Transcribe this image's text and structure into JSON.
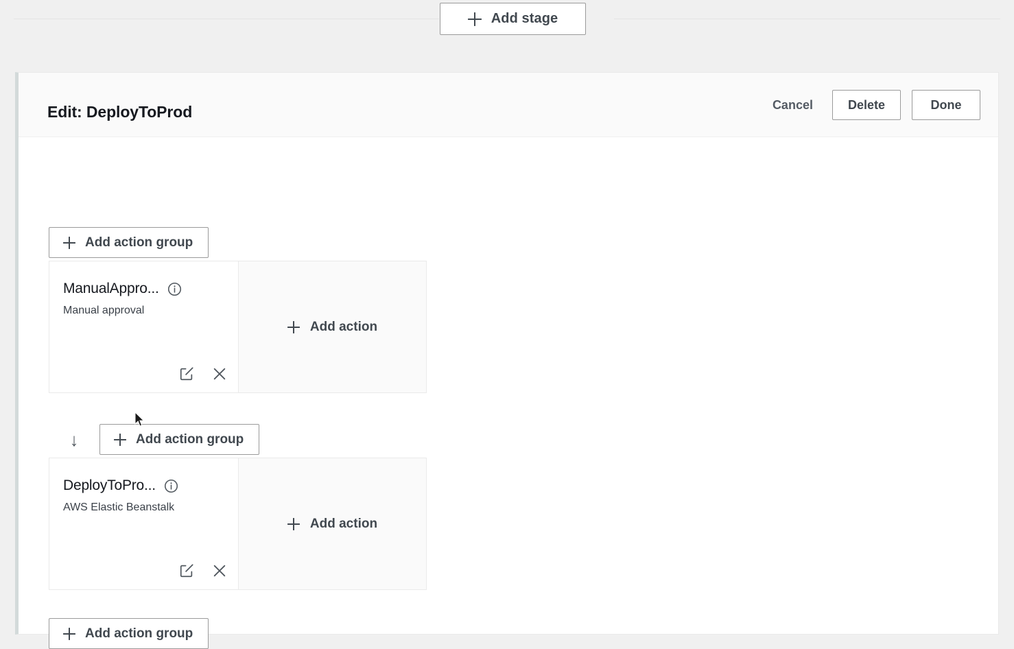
{
  "top_bar": {
    "add_stage_label": "Add stage",
    "add_stage_icon": "plus-icon"
  },
  "edit_panel": {
    "title": "Edit: DeployToProd",
    "cancel_label": "Cancel",
    "delete_label": "Delete",
    "done_label": "Done",
    "top_add_action_group_label": "Add action group",
    "middle_add_action_group_label": "Add action group",
    "bottom_add_action_group_label": "Add action group",
    "flow_arrow_glyph": "↓",
    "action_groups": [
      {
        "name": "ManualAppro...",
        "provider": "Manual approval",
        "info_icon": "info-circle-icon",
        "edit_icon": "edit-square-icon",
        "remove_icon": "close-x-icon",
        "add_action_label": "Add action"
      },
      {
        "name": "DeployToPro...",
        "provider": "AWS Elastic Beanstalk",
        "info_icon": "info-circle-icon",
        "edit_icon": "edit-square-icon",
        "remove_icon": "close-x-icon",
        "add_action_label": "Add action"
      }
    ]
  },
  "colors": {
    "page_background": "#f0f0f0",
    "panel_background": "#ffffff",
    "panel_header_background": "#fafafa",
    "panel_accent_border": "#d3dada",
    "text_primary": "#16191f",
    "text_secondary": "#545b64",
    "button_border": "#9a9a9a",
    "card_border": "#eaeaea",
    "add_action_background": "#fafafa"
  }
}
